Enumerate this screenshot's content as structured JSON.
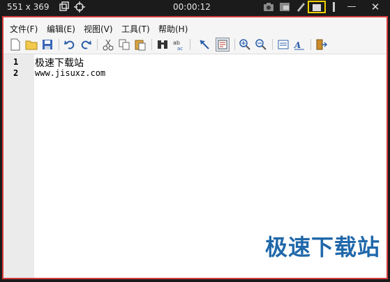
{
  "recorder": {
    "dimensions": "551 x 369",
    "timer": "00:00:12"
  },
  "menu": {
    "file": "文件(F)",
    "edit": "编辑(E)",
    "view": "视图(V)",
    "tools": "工具(T)",
    "help": "帮助(H)"
  },
  "editor": {
    "lines": [
      {
        "number": "1",
        "text": "极速下载站"
      },
      {
        "number": "2",
        "text": "www.jisuxz.com"
      }
    ]
  },
  "watermark": "极速下载站",
  "colors": {
    "window_border": "#d43c3c",
    "accent": "#1560a6",
    "record_highlight": "#f0d000"
  }
}
